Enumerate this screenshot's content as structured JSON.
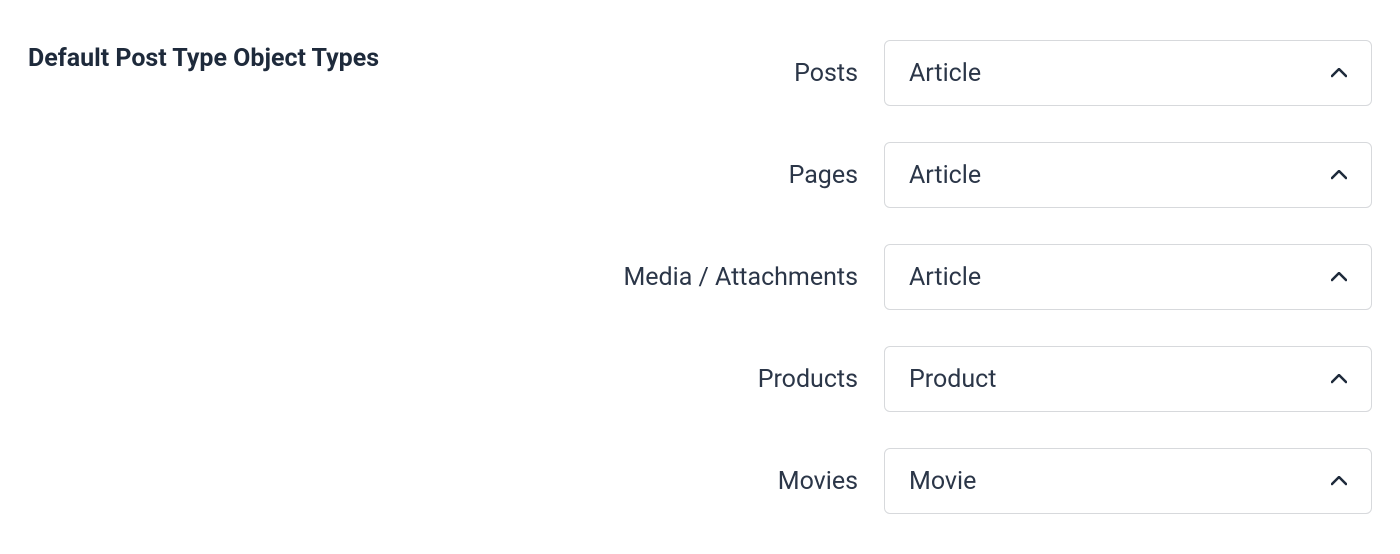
{
  "section": {
    "title": "Default Post Type Object Types"
  },
  "fields": [
    {
      "label": "Posts",
      "value": "Article"
    },
    {
      "label": "Pages",
      "value": "Article"
    },
    {
      "label": "Media / Attachments",
      "value": "Article"
    },
    {
      "label": "Products",
      "value": "Product"
    },
    {
      "label": "Movies",
      "value": "Movie"
    }
  ]
}
